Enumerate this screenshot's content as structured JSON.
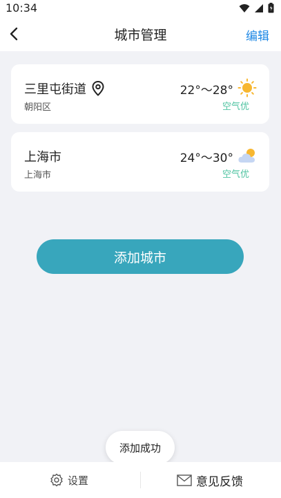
{
  "status_bar": {
    "time": "10:34"
  },
  "nav": {
    "title": "城市管理",
    "edit_label": "编辑"
  },
  "cities": [
    {
      "name": "三里屯街道",
      "district": "朝阳区",
      "temp": "22°～28°",
      "aqi": "空气优",
      "weather_icon": "sunny-icon",
      "location_icon": "location-pin-icon"
    },
    {
      "name": "上海市",
      "district": "上海市",
      "temp": "24°～30°",
      "aqi": "空气优",
      "weather_icon": "partly-cloudy-icon"
    }
  ],
  "add_city_label": "添加城市",
  "toast": "添加成功",
  "bottom_bar": {
    "settings_label": "设置",
    "feedback_label": "意见反馈"
  },
  "colors": {
    "accent": "#38a6bc",
    "link": "#1e88e5",
    "aqi_good": "#4fc3a1",
    "sun": "#f7b731"
  }
}
